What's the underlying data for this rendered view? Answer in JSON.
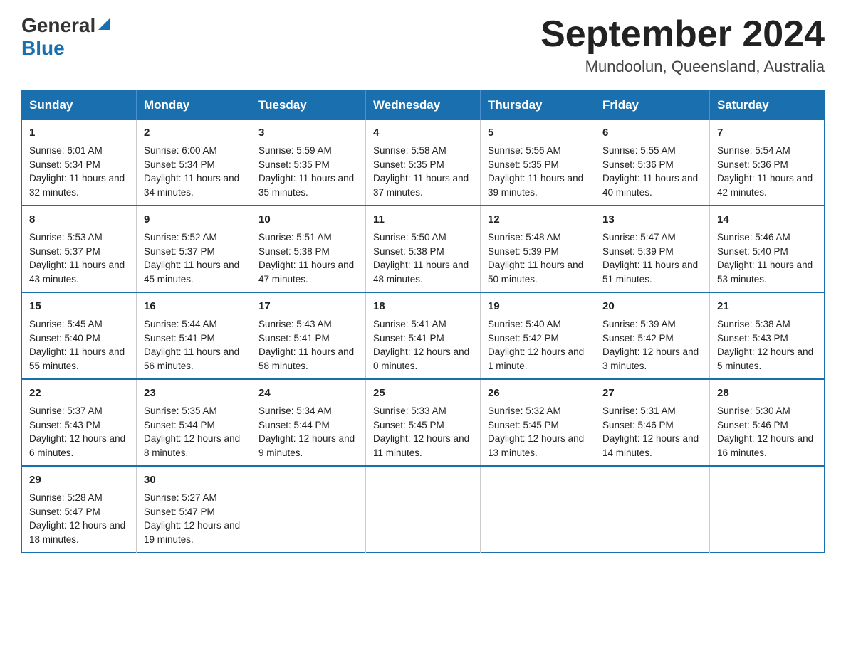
{
  "header": {
    "logo_general": "General",
    "logo_blue": "Blue",
    "month_title": "September 2024",
    "location": "Mundoolun, Queensland, Australia"
  },
  "weekdays": [
    "Sunday",
    "Monday",
    "Tuesday",
    "Wednesday",
    "Thursday",
    "Friday",
    "Saturday"
  ],
  "weeks": [
    [
      {
        "day": "1",
        "sunrise": "6:01 AM",
        "sunset": "5:34 PM",
        "daylight": "11 hours and 32 minutes."
      },
      {
        "day": "2",
        "sunrise": "6:00 AM",
        "sunset": "5:34 PM",
        "daylight": "11 hours and 34 minutes."
      },
      {
        "day": "3",
        "sunrise": "5:59 AM",
        "sunset": "5:35 PM",
        "daylight": "11 hours and 35 minutes."
      },
      {
        "day": "4",
        "sunrise": "5:58 AM",
        "sunset": "5:35 PM",
        "daylight": "11 hours and 37 minutes."
      },
      {
        "day": "5",
        "sunrise": "5:56 AM",
        "sunset": "5:35 PM",
        "daylight": "11 hours and 39 minutes."
      },
      {
        "day": "6",
        "sunrise": "5:55 AM",
        "sunset": "5:36 PM",
        "daylight": "11 hours and 40 minutes."
      },
      {
        "day": "7",
        "sunrise": "5:54 AM",
        "sunset": "5:36 PM",
        "daylight": "11 hours and 42 minutes."
      }
    ],
    [
      {
        "day": "8",
        "sunrise": "5:53 AM",
        "sunset": "5:37 PM",
        "daylight": "11 hours and 43 minutes."
      },
      {
        "day": "9",
        "sunrise": "5:52 AM",
        "sunset": "5:37 PM",
        "daylight": "11 hours and 45 minutes."
      },
      {
        "day": "10",
        "sunrise": "5:51 AM",
        "sunset": "5:38 PM",
        "daylight": "11 hours and 47 minutes."
      },
      {
        "day": "11",
        "sunrise": "5:50 AM",
        "sunset": "5:38 PM",
        "daylight": "11 hours and 48 minutes."
      },
      {
        "day": "12",
        "sunrise": "5:48 AM",
        "sunset": "5:39 PM",
        "daylight": "11 hours and 50 minutes."
      },
      {
        "day": "13",
        "sunrise": "5:47 AM",
        "sunset": "5:39 PM",
        "daylight": "11 hours and 51 minutes."
      },
      {
        "day": "14",
        "sunrise": "5:46 AM",
        "sunset": "5:40 PM",
        "daylight": "11 hours and 53 minutes."
      }
    ],
    [
      {
        "day": "15",
        "sunrise": "5:45 AM",
        "sunset": "5:40 PM",
        "daylight": "11 hours and 55 minutes."
      },
      {
        "day": "16",
        "sunrise": "5:44 AM",
        "sunset": "5:41 PM",
        "daylight": "11 hours and 56 minutes."
      },
      {
        "day": "17",
        "sunrise": "5:43 AM",
        "sunset": "5:41 PM",
        "daylight": "11 hours and 58 minutes."
      },
      {
        "day": "18",
        "sunrise": "5:41 AM",
        "sunset": "5:41 PM",
        "daylight": "12 hours and 0 minutes."
      },
      {
        "day": "19",
        "sunrise": "5:40 AM",
        "sunset": "5:42 PM",
        "daylight": "12 hours and 1 minute."
      },
      {
        "day": "20",
        "sunrise": "5:39 AM",
        "sunset": "5:42 PM",
        "daylight": "12 hours and 3 minutes."
      },
      {
        "day": "21",
        "sunrise": "5:38 AM",
        "sunset": "5:43 PM",
        "daylight": "12 hours and 5 minutes."
      }
    ],
    [
      {
        "day": "22",
        "sunrise": "5:37 AM",
        "sunset": "5:43 PM",
        "daylight": "12 hours and 6 minutes."
      },
      {
        "day": "23",
        "sunrise": "5:35 AM",
        "sunset": "5:44 PM",
        "daylight": "12 hours and 8 minutes."
      },
      {
        "day": "24",
        "sunrise": "5:34 AM",
        "sunset": "5:44 PM",
        "daylight": "12 hours and 9 minutes."
      },
      {
        "day": "25",
        "sunrise": "5:33 AM",
        "sunset": "5:45 PM",
        "daylight": "12 hours and 11 minutes."
      },
      {
        "day": "26",
        "sunrise": "5:32 AM",
        "sunset": "5:45 PM",
        "daylight": "12 hours and 13 minutes."
      },
      {
        "day": "27",
        "sunrise": "5:31 AM",
        "sunset": "5:46 PM",
        "daylight": "12 hours and 14 minutes."
      },
      {
        "day": "28",
        "sunrise": "5:30 AM",
        "sunset": "5:46 PM",
        "daylight": "12 hours and 16 minutes."
      }
    ],
    [
      {
        "day": "29",
        "sunrise": "5:28 AM",
        "sunset": "5:47 PM",
        "daylight": "12 hours and 18 minutes."
      },
      {
        "day": "30",
        "sunrise": "5:27 AM",
        "sunset": "5:47 PM",
        "daylight": "12 hours and 19 minutes."
      },
      null,
      null,
      null,
      null,
      null
    ]
  ],
  "labels": {
    "sunrise": "Sunrise:",
    "sunset": "Sunset:",
    "daylight": "Daylight:"
  }
}
